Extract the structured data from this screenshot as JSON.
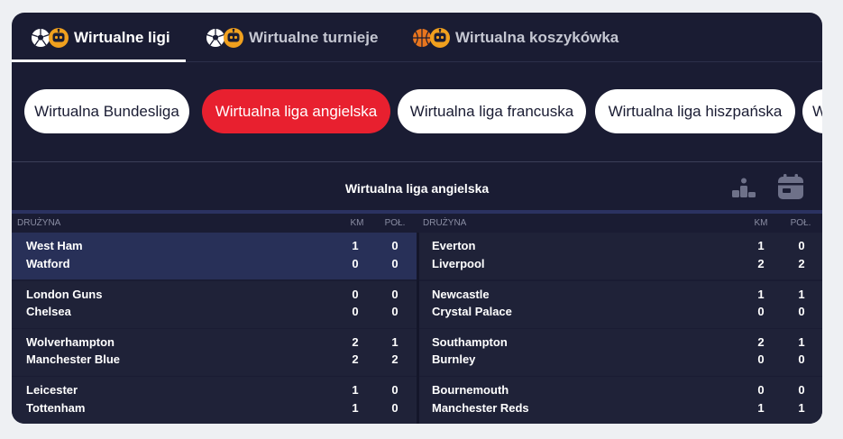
{
  "tabs": [
    {
      "label": "Wirtualne ligi",
      "active": true
    },
    {
      "label": "Wirtualne turnieje",
      "active": false
    },
    {
      "label": "Wirtualna koszykówka",
      "active": false
    }
  ],
  "leagues": [
    {
      "label": "Wirtualna Bundesliga",
      "active": false
    },
    {
      "label": "Wirtualna liga angielska",
      "active": true
    },
    {
      "label": "Wirtualna liga francuska",
      "active": false
    },
    {
      "label": "Wirtualna liga hiszpańska",
      "active": false
    },
    {
      "label": "W",
      "active": false
    }
  ],
  "table": {
    "title": "Wirtualna liga angielska",
    "headers": {
      "team": "DRUŻYNA",
      "km": "KM",
      "pol": "POŁ."
    },
    "left": [
      {
        "home": "West Ham",
        "away": "Watford",
        "home_km": "1",
        "home_pol": "0",
        "away_km": "0",
        "away_pol": "0",
        "highlight": true
      },
      {
        "home": "London Guns",
        "away": "Chelsea",
        "home_km": "0",
        "home_pol": "0",
        "away_km": "0",
        "away_pol": "0"
      },
      {
        "home": "Wolverhampton",
        "away": "Manchester Blue",
        "home_km": "2",
        "home_pol": "1",
        "away_km": "2",
        "away_pol": "2"
      },
      {
        "home": "Leicester",
        "away": "Tottenham",
        "home_km": "1",
        "home_pol": "0",
        "away_km": "1",
        "away_pol": "0"
      }
    ],
    "right": [
      {
        "home": "Everton",
        "away": "Liverpool",
        "home_km": "1",
        "home_pol": "0",
        "away_km": "2",
        "away_pol": "2"
      },
      {
        "home": "Newcastle",
        "away": "Crystal Palace",
        "home_km": "1",
        "home_pol": "1",
        "away_km": "0",
        "away_pol": "0"
      },
      {
        "home": "Southampton",
        "away": "Burnley",
        "home_km": "2",
        "home_pol": "1",
        "away_km": "0",
        "away_pol": "0"
      },
      {
        "home": "Bournemouth",
        "away": "Manchester Reds",
        "home_km": "0",
        "home_pol": "0",
        "away_km": "1",
        "away_pol": "1"
      }
    ]
  },
  "icons": {
    "standings": "podium-icon",
    "schedule": "calendar-icon"
  },
  "colors": {
    "panel": "#1a1c33",
    "accent": "#e8202f",
    "highlight_row": "#283058",
    "robot": "#f0a01e"
  }
}
